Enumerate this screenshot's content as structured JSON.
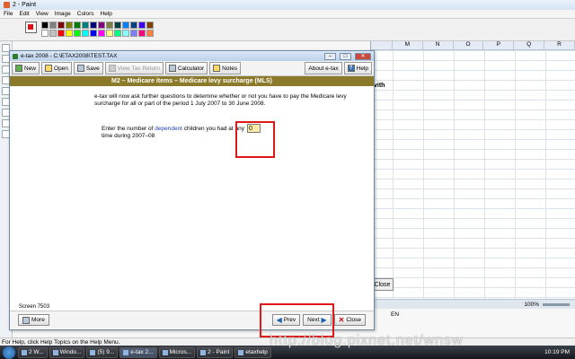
{
  "paint": {
    "title": "2 - Paint",
    "menu": [
      "File",
      "Edit",
      "View",
      "Image",
      "Colors",
      "Help"
    ],
    "status": "For Help, click Help Topics on the Help Menu.",
    "palette": [
      "#000000",
      "#808080",
      "#800000",
      "#808000",
      "#008000",
      "#008080",
      "#000080",
      "#800080",
      "#808040",
      "#004040",
      "#0080ff",
      "#004080",
      "#4000ff",
      "#804000",
      "#ffffff",
      "#c0c0c0",
      "#ff0000",
      "#ffff00",
      "#00ff00",
      "#00ffff",
      "#0000ff",
      "#ff00ff",
      "#ffff80",
      "#00ff80",
      "#80ffff",
      "#8080ff",
      "#ff0080",
      "#ff8040"
    ]
  },
  "excel": {
    "columns": [
      "",
      "M",
      "N",
      "O",
      "P",
      "Q",
      "R"
    ],
    "cell_text": "vith",
    "close_label": "Close",
    "zoom": "100%"
  },
  "etax": {
    "title": "e-tax 2008 - C:\\ETAX2008\\TEST.TAX",
    "toolbar": {
      "new": "New",
      "open": "Open",
      "save": "Save",
      "view_tax_return": "View Tax Return",
      "calculator": "Calculator",
      "notes": "Notes",
      "about": "About e-tax",
      "help": "Help"
    },
    "header": "M2 – Medicare items – Medicare levy surcharge (MLS)",
    "intro": "e-tax will now ask further questions to detemine whether or not you have to pay the Medicare levy surcharge for all or part of the period 1 July 2007 to 30 June 2008.",
    "question_pre": "Enter the number of ",
    "question_link": "dependent",
    "question_post": " children you had at any time during 2007–08",
    "answer_value": "0",
    "screen": "Screen 7503",
    "footer": {
      "more": "More",
      "prev": "Prev",
      "next": "Next",
      "close": "Close"
    }
  },
  "taskbar": {
    "items": [
      "2 W...",
      "Windo...",
      "(5) 9...",
      "e-tax 2...",
      "Micros...",
      "2 - Paint",
      "etaxhelp"
    ],
    "lang": "EN",
    "time": "10:19 PM"
  },
  "watermark": "http://blog.pixnet.net/wnsw",
  "colors": {
    "header_bg": "#8a7a2a",
    "highlight": "#e01818",
    "input_bg": "#ffe9a8",
    "link": "#1f3fb5"
  }
}
